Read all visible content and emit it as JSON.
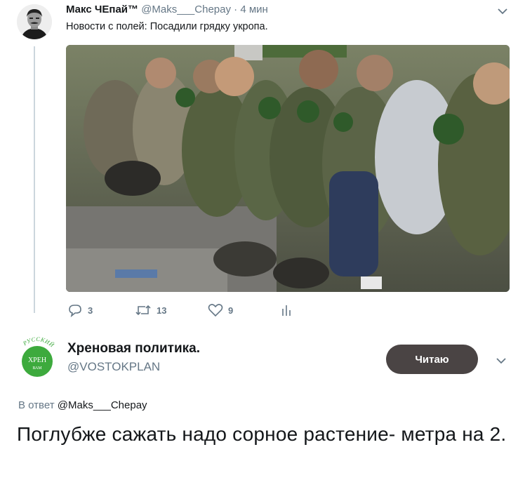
{
  "tweet1": {
    "author_name": "Макс ЧЕпай™",
    "handle": "@Maks___Chepay",
    "separator": "·",
    "time": "4 мин",
    "text": "Новости с полей: Посадили грядку укропа.",
    "image_icon": "photo-of-kneeling-soldiers",
    "actions": {
      "reply_count": "3",
      "retweet_count": "13",
      "like_count": "9"
    }
  },
  "tweet2": {
    "author_name": "Хреновая политика.",
    "handle": "@VOSTOKPLAN",
    "avatar_text": {
      "arc": "РУССКИЙ",
      "main": "ХРЕН",
      "sub": "ВАМ"
    },
    "follow_label": "Читаю",
    "reply_prefix": "В ответ",
    "reply_mention": "@Maks___Chepay",
    "text": "Поглубже сажать надо сорное растение- метра на 2."
  },
  "colors": {
    "text": "#14171a",
    "muted": "#657786",
    "button": "#4a4444",
    "thread_line": "#ccd6dd",
    "avatar_green": "#3daa3d"
  }
}
